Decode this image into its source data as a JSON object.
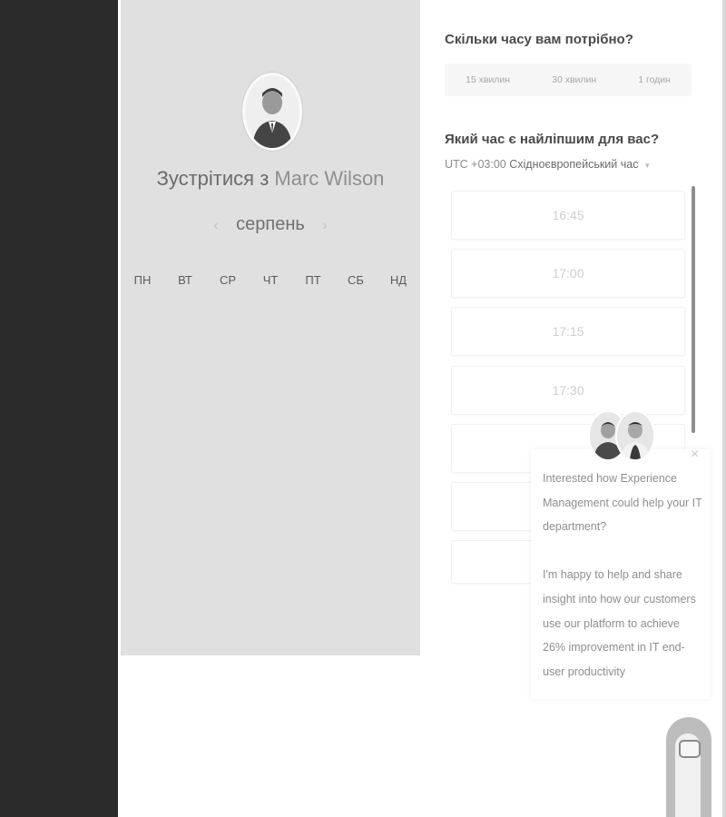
{
  "profile": {
    "meet_prefix": "Зустрітися з",
    "meet_name": "Marc Wilson"
  },
  "calendar": {
    "month": "серпень",
    "prev_icon": "‹",
    "next_icon": "›",
    "weekdays": [
      "ПН",
      "ВТ",
      "СР",
      "ЧТ",
      "ПТ",
      "СБ",
      "НД"
    ]
  },
  "duration": {
    "title": "Скільки часу вам потрібно?",
    "options": [
      "15 хвилин",
      "30 хвилин",
      "1 годин"
    ]
  },
  "time": {
    "title": "Який час є найліпшим для вас?",
    "tz_offset": "UTC +03:00",
    "tz_name": "Східноєвропейський час",
    "tz_caret": "▾",
    "slots": [
      "16:45",
      "17:00",
      "17:15",
      "17:30"
    ]
  },
  "chat": {
    "close": "×",
    "message_1": "Interested how Experience Management could help your IT department?",
    "message_2": "I'm happy to help and share insight into how our customers use our platform to achieve 26% improvement in IT end-user productivity"
  },
  "icons": {
    "avatar": "avatar-icon",
    "close": "close-icon",
    "chevron_left": "chevron-left-icon",
    "chevron_right": "chevron-right-icon",
    "chat_launcher": "chat-launcher-icon"
  }
}
